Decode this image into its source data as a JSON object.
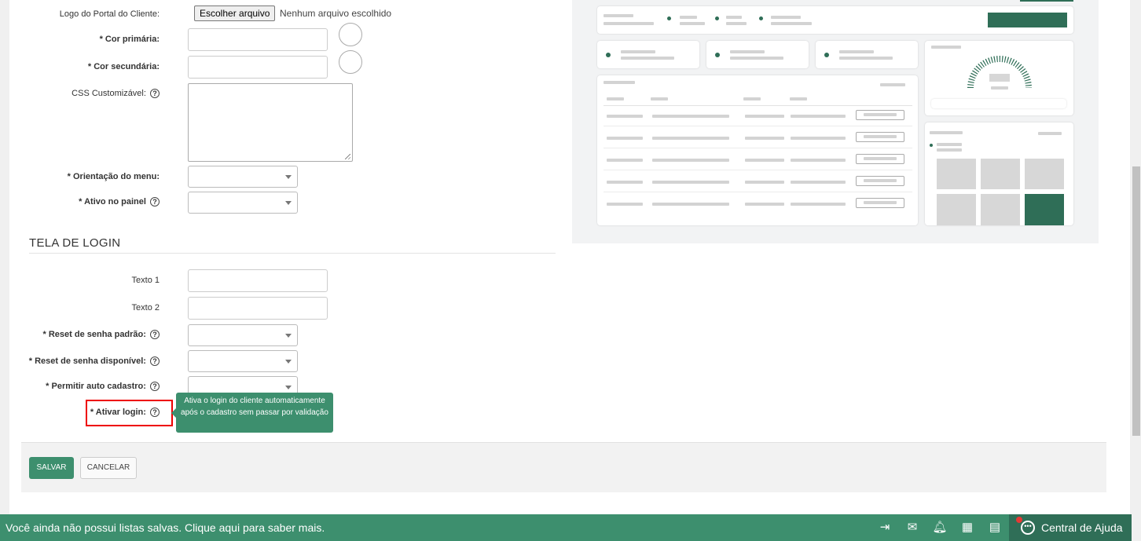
{
  "form": {
    "logo_label": "Logo do Portal do Cliente:",
    "file_button": "Escolher arquivo",
    "file_status": "Nenhum arquivo escolhido",
    "primary_color_label": "* Cor primária:",
    "secondary_color_label": "* Cor secundária:",
    "css_label": "CSS Customizável:",
    "menu_orientation_label": "* Orientação do menu:",
    "panel_active_label": "* Ativo no painel"
  },
  "login_section": {
    "title": "TELA DE LOGIN",
    "text1_label": "Texto 1",
    "text2_label": "Texto 2",
    "reset_default_label": "* Reset de senha padrão:",
    "reset_available_label": "* Reset de senha disponível:",
    "self_signup_label": "* Permitir auto cadastro:",
    "activate_login_label": "* Ativar login:",
    "tooltip": "Ativa o login do cliente automaticamente após o cadastro sem passar por validação"
  },
  "help_glyph": "?",
  "actions": {
    "save": "SALVAR",
    "cancel": "CANCELAR"
  },
  "footer": {
    "message": "Você ainda não possui listas salvas. Clique aqui para saber mais.",
    "help_center": "Central de Ajuda",
    "icons": [
      "collapse-icon",
      "mail-star-icon",
      "bell-icon",
      "calendar-icon",
      "calculator-icon"
    ]
  },
  "colors": {
    "brand_green": "#3d8f6e",
    "dark_green": "#2f6e57",
    "highlight_red": "#e00000"
  }
}
